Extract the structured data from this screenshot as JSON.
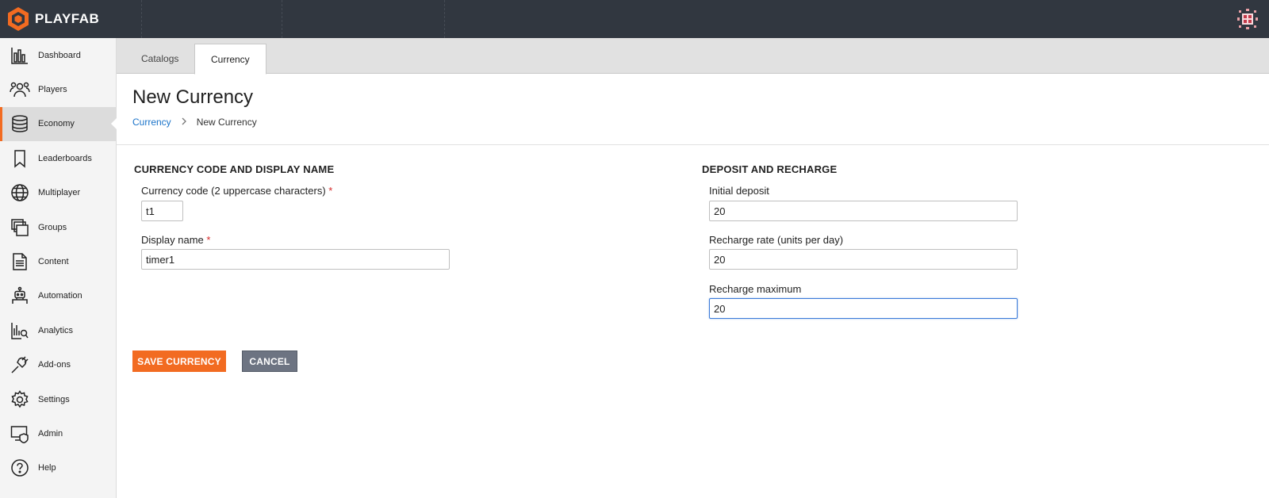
{
  "app": {
    "logo_text": "PLAYFAB",
    "brand_color": "#f26b21"
  },
  "sidebar": {
    "items": [
      {
        "label": "Dashboard",
        "icon": "bar-chart-icon",
        "active": false
      },
      {
        "label": "Players",
        "icon": "players-icon",
        "active": false
      },
      {
        "label": "Economy",
        "icon": "database-icon",
        "active": true
      },
      {
        "label": "Leaderboards",
        "icon": "bookmark-icon",
        "active": false
      },
      {
        "label": "Multiplayer",
        "icon": "globe-icon",
        "active": false
      },
      {
        "label": "Groups",
        "icon": "groups-icon",
        "active": false
      },
      {
        "label": "Content",
        "icon": "document-icon",
        "active": false
      },
      {
        "label": "Automation",
        "icon": "robot-icon",
        "active": false
      },
      {
        "label": "Analytics",
        "icon": "analytics-icon",
        "active": false
      },
      {
        "label": "Add-ons",
        "icon": "plug-icon",
        "active": false
      },
      {
        "label": "Settings",
        "icon": "gear-icon",
        "active": false
      },
      {
        "label": "Admin",
        "icon": "admin-shield-icon",
        "active": false
      },
      {
        "label": "Help",
        "icon": "help-icon",
        "active": false
      }
    ]
  },
  "tabs": [
    {
      "label": "Catalogs",
      "active": false
    },
    {
      "label": "Currency",
      "active": true
    }
  ],
  "page": {
    "title": "New Currency",
    "breadcrumb": {
      "link": "Currency",
      "separator": ">",
      "current": "New Currency"
    }
  },
  "form": {
    "left_section_title": "CURRENCY CODE AND DISPLAY NAME",
    "right_section_title": "DEPOSIT AND RECHARGE",
    "required_mark": "*",
    "currency_code": {
      "label": "Currency code (2 uppercase characters)",
      "value": "t1"
    },
    "display_name": {
      "label": "Display name",
      "value": "timer1"
    },
    "initial_deposit": {
      "label": "Initial deposit",
      "value": "20"
    },
    "recharge_rate": {
      "label": "Recharge rate (units per day)",
      "value": "20"
    },
    "recharge_maximum": {
      "label": "Recharge maximum",
      "value": "20"
    }
  },
  "actions": {
    "save_label": "SAVE CURRENCY",
    "cancel_label": "CANCEL"
  }
}
